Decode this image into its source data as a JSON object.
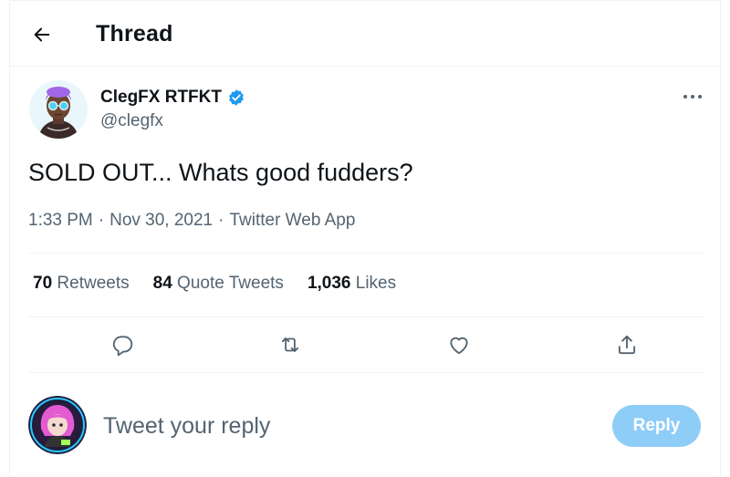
{
  "header": {
    "back_icon": "arrow-left-icon",
    "title": "Thread"
  },
  "tweet": {
    "author": {
      "display_name": "ClegFX RTFKT",
      "handle": "@clegfx",
      "verified": true,
      "verified_color": "#1d9bf0"
    },
    "more_icon": "more-horizontal-icon",
    "text": "SOLD OUT... Whats good fudders?",
    "time": "1:33 PM",
    "date": "Nov 30, 2021",
    "separator": "·",
    "source": "Twitter Web App"
  },
  "stats": {
    "retweets_count": "70",
    "retweets_label": "Retweets",
    "quotes_count": "84",
    "quotes_label": "Quote Tweets",
    "likes_count": "1,036",
    "likes_label": "Likes"
  },
  "actions": {
    "reply_icon": "comment-icon",
    "retweet_icon": "retweet-icon",
    "like_icon": "heart-icon",
    "share_icon": "share-icon"
  },
  "reply": {
    "placeholder": "Tweet your reply",
    "button_label": "Reply",
    "button_color": "#8ecdf8"
  },
  "colors": {
    "text_primary": "#0f1419",
    "text_secondary": "#536471",
    "border": "#eff3f4"
  }
}
